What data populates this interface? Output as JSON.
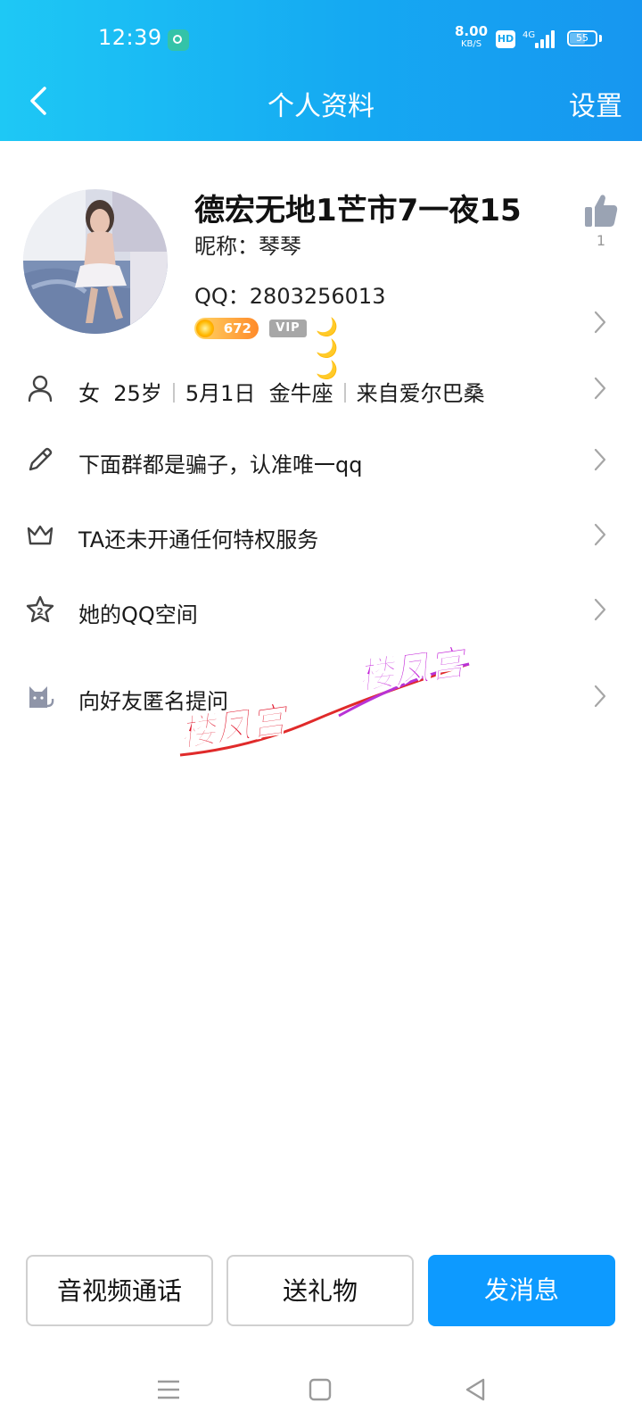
{
  "status_bar": {
    "time": "12:39",
    "net_speed_value": "8.00",
    "net_speed_unit": "KB/S",
    "hd_badge": "HD",
    "network": "4G",
    "battery_level": "55"
  },
  "header": {
    "title": "个人资料",
    "settings_label": "设置",
    "back_icon": "chevron-left-icon",
    "gradient_colors": [
      "#1ec8f5",
      "#1796f0"
    ]
  },
  "profile": {
    "display_name": "德宏无地1芒市7一夜15",
    "nickname": "昵称：琴琴",
    "qq_number": "QQ：2803256013",
    "level": "672",
    "vip_badge": "VIP",
    "moons": "🌙🌙🌙",
    "likes": "1"
  },
  "info_rows": {
    "basic": {
      "gender": "女",
      "age": "25岁",
      "birthday": "5月1日",
      "zodiac": "金牛座",
      "location": "来自爱尔巴桑",
      "icon": "person-icon"
    },
    "signature": {
      "text": "下面群都是骗子，认准唯一qq",
      "icon": "pencil-icon"
    },
    "privilege": {
      "text": "TA还未开通任何特权服务",
      "icon": "crown-icon"
    },
    "qzone": {
      "text": "她的QQ空间",
      "icon": "star-icon"
    },
    "anonymous_question": {
      "text": "向好友匿名提问",
      "icon": "cat-icon"
    }
  },
  "watermark": {
    "text_1": "楼凤宫",
    "text_2": "楼凤宫"
  },
  "actions": {
    "call": "音视频通话",
    "gift": "送礼物",
    "message": "发消息",
    "accent_color": "#0d9aff"
  },
  "nav_bar": {
    "menu_icon": "menu-icon",
    "home_icon": "home-square-icon",
    "back_icon": "back-triangle-icon"
  }
}
